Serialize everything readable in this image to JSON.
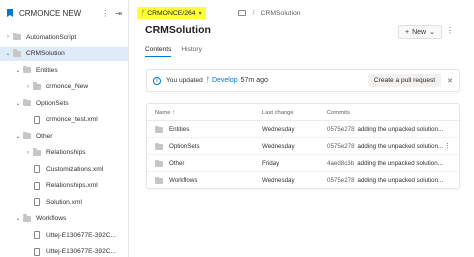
{
  "sidebar": {
    "repo_name": "CRMONCE NEW",
    "tree": [
      {
        "label": "AutomationScript",
        "kind": "folder",
        "depth": 1,
        "expanded": false
      },
      {
        "label": "CRMSolution",
        "kind": "folder",
        "depth": 1,
        "expanded": true,
        "selected": true
      },
      {
        "label": "Entities",
        "kind": "folder",
        "depth": 2,
        "expanded": true
      },
      {
        "label": "crmonce_New",
        "kind": "folder",
        "depth": 3,
        "expanded": false
      },
      {
        "label": "OptionSets",
        "kind": "folder",
        "depth": 2,
        "expanded": true
      },
      {
        "label": "crmonce_test.xml",
        "kind": "file",
        "depth": 3
      },
      {
        "label": "Other",
        "kind": "folder",
        "depth": 2,
        "expanded": true
      },
      {
        "label": "Relationships",
        "kind": "folder",
        "depth": 3,
        "expanded": false
      },
      {
        "label": "Customizations.xml",
        "kind": "file",
        "depth": 3
      },
      {
        "label": "Relationships.xml",
        "kind": "file",
        "depth": 3
      },
      {
        "label": "Solution.xml",
        "kind": "file",
        "depth": 3
      },
      {
        "label": "Workflows",
        "kind": "folder",
        "depth": 2,
        "expanded": true
      },
      {
        "label": "Uttej-E130677E-392C...",
        "kind": "file",
        "depth": 3
      },
      {
        "label": "Uttej-E130677E-392C...",
        "kind": "file",
        "depth": 3
      }
    ]
  },
  "topbar": {
    "branch": "CRMONCE/264",
    "breadcrumb": "CRMSolution"
  },
  "page": {
    "title": "CRMSolution",
    "new_label": "New",
    "tabs": [
      {
        "label": "Contents",
        "active": true
      },
      {
        "label": "History",
        "active": false
      }
    ]
  },
  "banner": {
    "text": "You updated",
    "branch": "Develop",
    "time": "57m ago",
    "button": "Create a pull request"
  },
  "table": {
    "headers": {
      "name": "Name ↑",
      "last_change": "Last change",
      "commits": "Commits"
    },
    "rows": [
      {
        "name": "Entities",
        "last_change": "Wednesday",
        "hash": "0575e278",
        "message": "adding the unpacked solution..."
      },
      {
        "name": "OptionSets",
        "last_change": "Wednesday",
        "hash": "0575e278",
        "message": "adding the unpacked solution..."
      },
      {
        "name": "Other",
        "last_change": "Friday",
        "hash": "4aed8c3b",
        "message": "adding the unpacked solution..."
      },
      {
        "name": "Workflows",
        "last_change": "Wednesday",
        "hash": "0575e278",
        "message": "adding the unpacked solution..."
      }
    ]
  },
  "colors": {
    "accent": "#0078d4",
    "highlight": "#ffff33",
    "selected_row": "#deecf9"
  }
}
